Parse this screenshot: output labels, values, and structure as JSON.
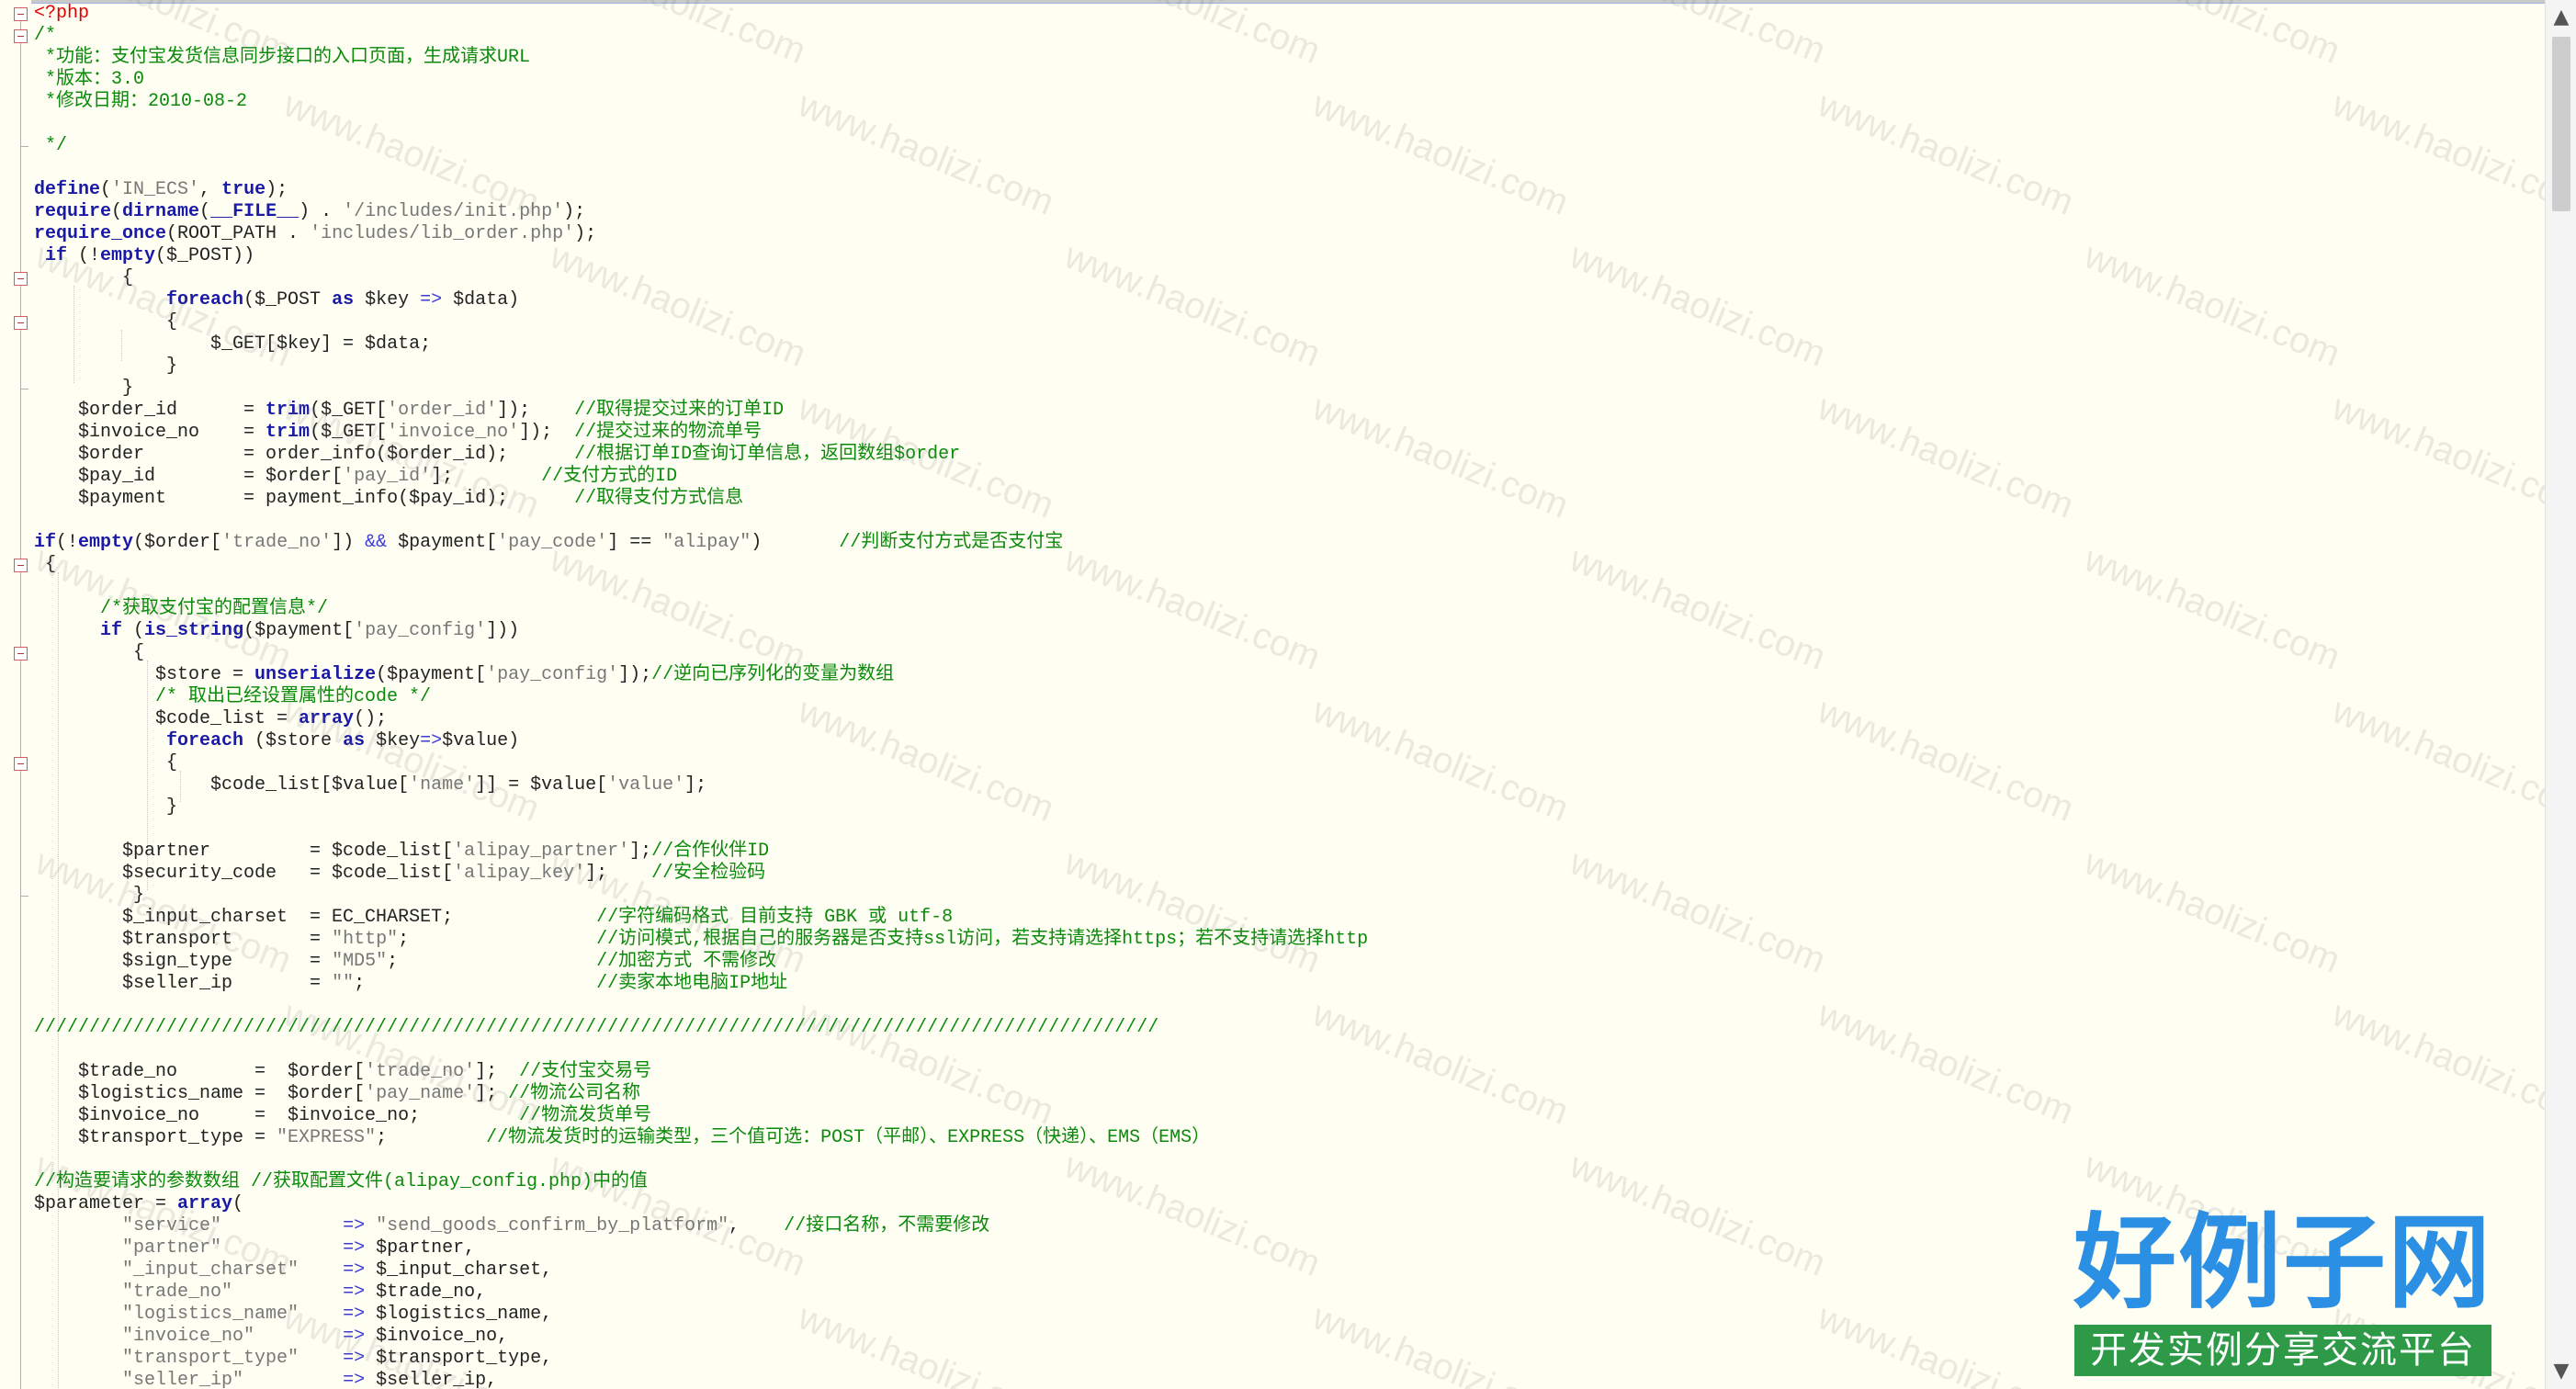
{
  "editor": {
    "colors": {
      "background": "#fffef2",
      "comment": "#0a8a0a",
      "keyword": "#1a1aa6",
      "string": "#777777",
      "php_tag": "#e00000",
      "logo_blue": "#2b8fe4",
      "logo_green": "#2e9a47"
    },
    "lines": [
      [
        [
          "tg",
          "<?php"
        ]
      ],
      [
        [
          "cm",
          "/*"
        ]
      ],
      [
        [
          "cm",
          " *功能：支付宝发货信息同步接口的入口页面，生成请求URL"
        ]
      ],
      [
        [
          "cm",
          " *版本：3.0"
        ]
      ],
      [
        [
          "cm",
          " *修改日期：2010-08-2"
        ]
      ],
      [
        [
          "cm",
          ""
        ]
      ],
      [
        [
          "cm",
          " */"
        ]
      ],
      [
        [
          "",
          ""
        ]
      ],
      [
        [
          "kw",
          "define"
        ],
        [
          "",
          "("
        ],
        [
          "st",
          "'IN_ECS'"
        ],
        [
          "",
          ", "
        ],
        [
          "kw",
          "true"
        ],
        [
          "",
          ");"
        ]
      ],
      [
        [
          "kw",
          "require"
        ],
        [
          "",
          "("
        ],
        [
          "kw",
          "dirname"
        ],
        [
          "",
          "("
        ],
        [
          "kw",
          "__FILE__"
        ],
        [
          "",
          ") . "
        ],
        [
          "st",
          "'/includes/init.php'"
        ],
        [
          "",
          ");"
        ]
      ],
      [
        [
          "kw",
          "require_once"
        ],
        [
          "",
          "(ROOT_PATH . "
        ],
        [
          "st",
          "'includes/lib_order.php'"
        ],
        [
          "",
          ");"
        ]
      ],
      [
        [
          "",
          ""
        ],
        [
          "kw",
          " if"
        ],
        [
          "",
          " (!"
        ],
        [
          "kw",
          "empty"
        ],
        [
          "",
          "($_POST))"
        ]
      ],
      [
        [
          "",
          "        {"
        ]
      ],
      [
        [
          "",
          "            "
        ],
        [
          "kw",
          "foreach"
        ],
        [
          "",
          "($_POST "
        ],
        [
          "kw",
          "as"
        ],
        [
          "",
          " $key "
        ],
        [
          "op",
          "=>"
        ],
        [
          "",
          " $data)"
        ]
      ],
      [
        [
          "",
          "            {"
        ]
      ],
      [
        [
          "",
          "                $_GET[$key] = $data;"
        ]
      ],
      [
        [
          "",
          "            }"
        ]
      ],
      [
        [
          "",
          "        }"
        ]
      ],
      [
        [
          "",
          "    $order_id      = "
        ],
        [
          "kw",
          "trim"
        ],
        [
          "",
          "($_GET["
        ],
        [
          "st",
          "'order_id'"
        ],
        [
          "",
          "]);    "
        ],
        [
          "cm",
          "//取得提交过来的订单ID"
        ]
      ],
      [
        [
          "",
          "    $invoice_no    = "
        ],
        [
          "kw",
          "trim"
        ],
        [
          "",
          "($_GET["
        ],
        [
          "st",
          "'invoice_no'"
        ],
        [
          "",
          "]);  "
        ],
        [
          "cm",
          "//提交过来的物流单号"
        ]
      ],
      [
        [
          "",
          "    $order         = order_info($order_id);      "
        ],
        [
          "cm",
          "//根据订单ID查询订单信息，返回数组$order"
        ]
      ],
      [
        [
          "",
          "    $pay_id        = $order["
        ],
        [
          "st",
          "'pay_id'"
        ],
        [
          "",
          "];        "
        ],
        [
          "cm",
          "//支付方式的ID"
        ]
      ],
      [
        [
          "",
          "    $payment       = payment_info($pay_id);      "
        ],
        [
          "cm",
          "//取得支付方式信息"
        ]
      ],
      [
        [
          "",
          ""
        ]
      ],
      [
        [
          "kw",
          "if"
        ],
        [
          "",
          "(!"
        ],
        [
          "kw",
          "empty"
        ],
        [
          "",
          "($order["
        ],
        [
          "st",
          "'trade_no'"
        ],
        [
          "",
          "]) "
        ],
        [
          "op",
          "&&"
        ],
        [
          "",
          " $payment["
        ],
        [
          "st",
          "'pay_code'"
        ],
        [
          "",
          "] == "
        ],
        [
          "st",
          "\"alipay\""
        ],
        [
          "",
          ")       "
        ],
        [
          "cm",
          "//判断支付方式是否支付宝"
        ]
      ],
      [
        [
          "",
          " {"
        ]
      ],
      [
        [
          "",
          ""
        ]
      ],
      [
        [
          "",
          "      "
        ],
        [
          "cm",
          "/*获取支付宝的配置信息*/"
        ]
      ],
      [
        [
          "",
          "      "
        ],
        [
          "kw",
          "if"
        ],
        [
          "",
          " ("
        ],
        [
          "kw",
          "is_string"
        ],
        [
          "",
          "($payment["
        ],
        [
          "st",
          "'pay_config'"
        ],
        [
          "",
          "]))"
        ]
      ],
      [
        [
          "",
          "         {"
        ]
      ],
      [
        [
          "",
          "           $store = "
        ],
        [
          "kw",
          "unserialize"
        ],
        [
          "",
          "($payment["
        ],
        [
          "st",
          "'pay_config'"
        ],
        [
          "",
          "]);"
        ],
        [
          "cm",
          "//逆向已序列化的变量为数组"
        ]
      ],
      [
        [
          "",
          "           "
        ],
        [
          "cm",
          "/* 取出已经设置属性的code */"
        ]
      ],
      [
        [
          "",
          "           $code_list = "
        ],
        [
          "kw",
          "array"
        ],
        [
          "",
          "();"
        ]
      ],
      [
        [
          "",
          "            "
        ],
        [
          "kw",
          "foreach"
        ],
        [
          "",
          " ($store "
        ],
        [
          "kw",
          "as"
        ],
        [
          "",
          " $key"
        ],
        [
          "op",
          "=>"
        ],
        [
          "",
          "$value)"
        ]
      ],
      [
        [
          "",
          "            {"
        ]
      ],
      [
        [
          "",
          "                $code_list[$value["
        ],
        [
          "st",
          "'name'"
        ],
        [
          "",
          "]] = $value["
        ],
        [
          "st",
          "'value'"
        ],
        [
          "",
          "];"
        ]
      ],
      [
        [
          "",
          "            }"
        ]
      ],
      [
        [
          "",
          ""
        ]
      ],
      [
        [
          "",
          "        $partner         = $code_list["
        ],
        [
          "st",
          "'alipay_partner'"
        ],
        [
          "",
          "];"
        ],
        [
          "cm",
          "//合作伙伴ID"
        ]
      ],
      [
        [
          "",
          "        $security_code   = $code_list["
        ],
        [
          "st",
          "'alipay_key'"
        ],
        [
          "",
          "];    "
        ],
        [
          "cm",
          "//安全检验码"
        ]
      ],
      [
        [
          "",
          "         }"
        ]
      ],
      [
        [
          "",
          "        $_input_charset  = EC_CHARSET;             "
        ],
        [
          "cm",
          "//字符编码格式 目前支持 GBK 或 utf-8"
        ]
      ],
      [
        [
          "",
          "        $transport       = "
        ],
        [
          "st",
          "\"http\""
        ],
        [
          "",
          ";                 "
        ],
        [
          "cm",
          "//访问模式,根据自己的服务器是否支持ssl访问，若支持请选择https；若不支持请选择http"
        ]
      ],
      [
        [
          "",
          "        $sign_type       = "
        ],
        [
          "st",
          "\"MD5\""
        ],
        [
          "",
          ";                  "
        ],
        [
          "cm",
          "//加密方式 不需修改"
        ]
      ],
      [
        [
          "",
          "        $seller_ip       = "
        ],
        [
          "st",
          "\"\""
        ],
        [
          "",
          ";                     "
        ],
        [
          "cm",
          "//卖家本地电脑IP地址"
        ]
      ],
      [
        [
          "",
          ""
        ]
      ],
      [
        [
          "cm",
          "//////////////////////////////////////////////////////////////////////////////////////////////////////"
        ]
      ],
      [
        [
          "",
          ""
        ]
      ],
      [
        [
          "",
          "    $trade_no       =  $order["
        ],
        [
          "st",
          "'trade_no'"
        ],
        [
          "",
          "];  "
        ],
        [
          "cm",
          "//支付宝交易号"
        ]
      ],
      [
        [
          "",
          "    $logistics_name =  $order["
        ],
        [
          "st",
          "'pay_name'"
        ],
        [
          "",
          "]; "
        ],
        [
          "cm",
          "//物流公司名称"
        ]
      ],
      [
        [
          "",
          "    $invoice_no     =  $invoice_no;         "
        ],
        [
          "cm",
          "//物流发货单号"
        ]
      ],
      [
        [
          "",
          "    $transport_type = "
        ],
        [
          "st",
          "\"EXPRESS\""
        ],
        [
          "",
          ";         "
        ],
        [
          "cm",
          "//物流发货时的运输类型，三个值可选：POST（平邮）、EXPRESS（快递）、EMS（EMS）"
        ]
      ],
      [
        [
          "",
          ""
        ]
      ],
      [
        [
          "cm",
          "//构造要请求的参数数组 //获取配置文件(alipay_config.php)中的值"
        ]
      ],
      [
        [
          "",
          "$parameter = "
        ],
        [
          "kw",
          "array"
        ],
        [
          "",
          "("
        ]
      ],
      [
        [
          "",
          "        "
        ],
        [
          "st",
          "\"service\""
        ],
        [
          "",
          "           "
        ],
        [
          "op",
          "=>"
        ],
        [
          "",
          " "
        ],
        [
          "st",
          "\"send_goods_confirm_by_platform\""
        ],
        [
          "",
          ",    "
        ],
        [
          "cm",
          "//接口名称，不需要修改"
        ]
      ],
      [
        [
          "",
          "        "
        ],
        [
          "st",
          "\"partner\""
        ],
        [
          "",
          "           "
        ],
        [
          "op",
          "=>"
        ],
        [
          "",
          " $partner,"
        ]
      ],
      [
        [
          "",
          "        "
        ],
        [
          "st",
          "\"_input_charset\""
        ],
        [
          "",
          "    "
        ],
        [
          "op",
          "=>"
        ],
        [
          "",
          " $_input_charset,"
        ]
      ],
      [
        [
          "",
          "        "
        ],
        [
          "st",
          "\"trade_no\""
        ],
        [
          "",
          "          "
        ],
        [
          "op",
          "=>"
        ],
        [
          "",
          " $trade_no,"
        ]
      ],
      [
        [
          "",
          "        "
        ],
        [
          "st",
          "\"logistics_name\""
        ],
        [
          "",
          "    "
        ],
        [
          "op",
          "=>"
        ],
        [
          "",
          " $logistics_name,"
        ]
      ],
      [
        [
          "",
          "        "
        ],
        [
          "st",
          "\"invoice_no\""
        ],
        [
          "",
          "        "
        ],
        [
          "op",
          "=>"
        ],
        [
          "",
          " $invoice_no,"
        ]
      ],
      [
        [
          "",
          "        "
        ],
        [
          "st",
          "\"transport_type\""
        ],
        [
          "",
          "    "
        ],
        [
          "op",
          "=>"
        ],
        [
          "",
          " $transport_type,"
        ]
      ],
      [
        [
          "",
          "        "
        ],
        [
          "st",
          "\"seller_ip\""
        ],
        [
          "",
          "         "
        ],
        [
          "op",
          "=>"
        ],
        [
          "",
          " $seller_ip,"
        ]
      ]
    ],
    "fold_markers": [
      0,
      1,
      12,
      14,
      25,
      29,
      34
    ],
    "fold_ends": [
      6,
      17,
      40
    ]
  },
  "watermark": {
    "text": "www.haolizi.com"
  },
  "logo": {
    "title": "好例子网",
    "subtitle": "开发实例分享交流平台"
  },
  "scrollbar": {
    "up_arrow": "▲",
    "down_arrow": "▼"
  }
}
